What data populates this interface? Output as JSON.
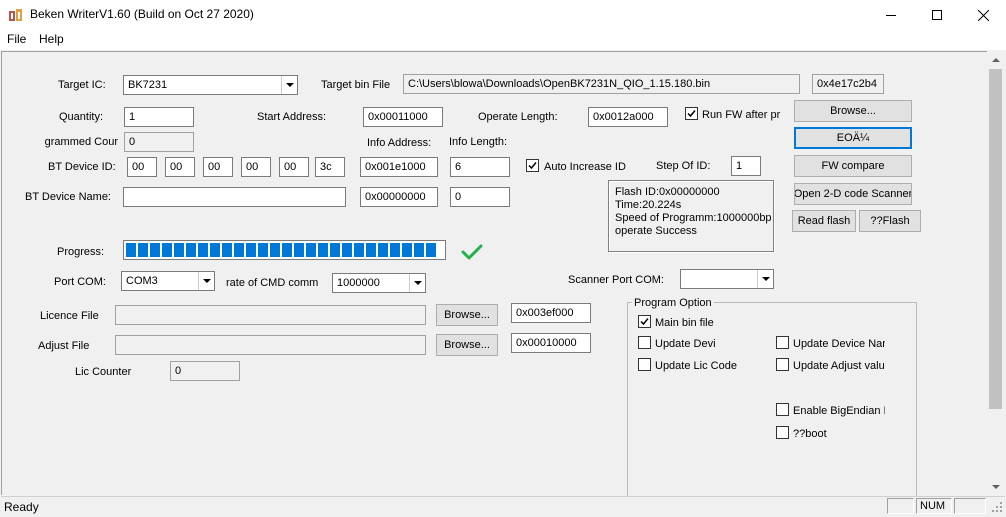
{
  "window": {
    "title": "Beken WriterV1.60 (Build on Oct 27 2020)"
  },
  "menu": [
    {
      "label": "File"
    },
    {
      "label": "Help"
    }
  ],
  "form": {
    "target_ic_label": "Target IC:",
    "target_ic_value": "BK7231",
    "target_bin_label": "Target bin File",
    "target_bin_value": "C:\\Users\\blowa\\Downloads\\OpenBK7231N_QIO_1.15.180.bin",
    "checksum_value": "0x4e17c2b4",
    "quantity_label": "Quantity:",
    "quantity_value": "1",
    "start_address_label": "Start Address:",
    "start_address_value": "0x00011000",
    "operate_length_label": "Operate Length:",
    "operate_length_value": "0x0012a000",
    "run_fw_label": "Run FW after pr",
    "run_fw_checked": true,
    "programmed_count_label": "grammed Cour",
    "programmed_count_value": "0",
    "info_address_label": "Info Address:",
    "info_length_label": "Info Length:",
    "bt_device_id_label": "BT Device ID:",
    "bt_id_bytes": [
      "00",
      "00",
      "00",
      "00",
      "00",
      "3c"
    ],
    "info_address_value": "0x001e1000",
    "info_length_value": "6",
    "auto_increase_label": "Auto Increase ID",
    "auto_increase_checked": true,
    "step_of_id_label": "Step Of ID:",
    "step_of_id_value": "1",
    "bt_device_name_label": "BT Device Name:",
    "bt_device_name_value": "",
    "name_address_value": "0x00000000",
    "name_length_value": "0",
    "progress_label": "Progress:",
    "progress_fraction": 1.0,
    "port_com_label": "Port COM:",
    "port_com_value": "COM3",
    "baud_label": "rate of CMD comm.",
    "baud_value": "1000000",
    "scanner_port_label": "Scanner Port COM:",
    "scanner_port_value": "",
    "licence_file_label": "Licence File",
    "licence_file_value": "",
    "licence_address_value": "0x003ef000",
    "adjust_file_label": "Adjust File",
    "adjust_file_value": "",
    "adjust_address_value": "0x00010000",
    "lic_counter_label": "Lic Counter",
    "lic_counter_value": "0"
  },
  "buttons": {
    "browse_main": "Browse...",
    "eoa": "EOÄ¼",
    "fw_compare": "FW compare",
    "open_2d_scanner": "Open 2-D code Scanner",
    "read_flash": "Read flash",
    "qq_flash": "??Flash",
    "browse_licence": "Browse...",
    "browse_adjust": "Browse..."
  },
  "info_box": {
    "lines": [
      "Flash ID:0x00000000",
      "Time:20.224s",
      "Speed of Programm:1000000bp",
      "operate Success"
    ]
  },
  "program_option": {
    "title": "Program Option",
    "main_bin_label": "Main bin file",
    "main_bin_checked": true,
    "update_devi_label": "Update Devi",
    "update_device_name_label": "Update Device Nan",
    "update_lic_code_label": "Update Lic Code",
    "update_adjust_label": "Update Adjust valu",
    "enable_bigendian_label": "Enable BigEndian II",
    "qq_boot_label": "??boot"
  },
  "status": {
    "text": "Ready",
    "num": "NUM"
  },
  "colors": {
    "progress": "#0078d7",
    "success_check": "#22b14c",
    "accent_focus": "#0078d7"
  }
}
